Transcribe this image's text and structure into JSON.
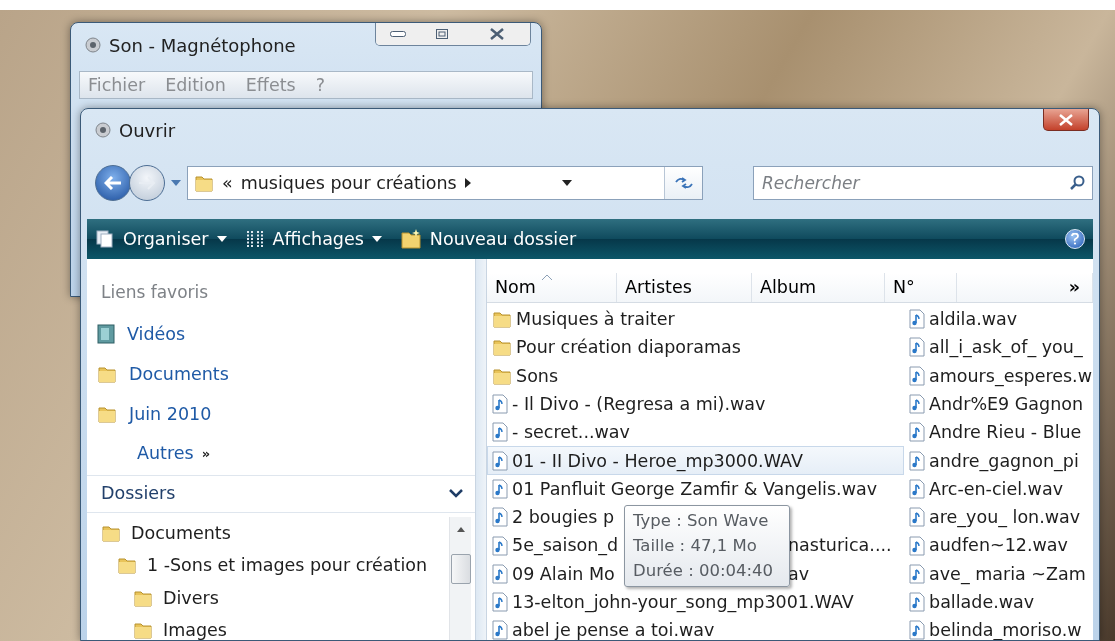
{
  "recorder_window": {
    "title": "Son - Magnétophone",
    "menu": [
      "Fichier",
      "Edition",
      "Effets",
      "?"
    ]
  },
  "dialog": {
    "title": "Ouvrir",
    "address": {
      "chevron": "«",
      "path": "musiques pour créations"
    },
    "search": {
      "placeholder": "Rechercher"
    },
    "toolbar": [
      {
        "label": "Organiser",
        "kind": "organize",
        "dropdown": true
      },
      {
        "label": "Affichages",
        "kind": "views",
        "dropdown": true
      },
      {
        "label": "Nouveau dossier",
        "kind": "new-folder",
        "dropdown": false
      }
    ],
    "favorites": {
      "title": "Liens favoris",
      "items": [
        {
          "label": "Vidéos",
          "kind": "videos"
        },
        {
          "label": "Documents",
          "kind": "folder"
        },
        {
          "label": "Juin 2010",
          "kind": "folder"
        }
      ],
      "more": "Autres",
      "more_glyph": "»"
    },
    "folders": {
      "title": "Dossiers",
      "expanded": true,
      "tree": [
        {
          "label": "Documents",
          "children": [
            {
              "label": "1 -Sons et images pour création",
              "children": [
                {
                  "label": "Divers"
                },
                {
                  "label": "Images"
                }
              ]
            }
          ]
        }
      ]
    },
    "columns": [
      {
        "label": "Nom",
        "sorted": true
      },
      {
        "label": "Artistes",
        "sorted": false
      },
      {
        "label": "Album",
        "sorted": false
      },
      {
        "label": "N°",
        "sorted": false
      }
    ],
    "more_columns": "»",
    "files_column_1": [
      {
        "name": "Musiques à traiter",
        "kind": "folder",
        "highlighted": false
      },
      {
        "name": "Pour création diaporamas",
        "kind": "folder",
        "highlighted": false
      },
      {
        "name": "Sons",
        "kind": "folder",
        "highlighted": false
      },
      {
        "name": "- Il Divo - (Regresa a mi).wav",
        "kind": "audio",
        "highlighted": false
      },
      {
        "name": "- secret...wav",
        "kind": "audio",
        "highlighted": false
      },
      {
        "name": "01 - II Divo - Heroe_mp3000.WAV",
        "kind": "audio",
        "highlighted": true
      },
      {
        "name": "01 Panfluit George Zamfir & Vangelis.wav",
        "kind": "audio",
        "highlighted": false
      },
      {
        "name": "2 bougies p",
        "kind": "audio",
        "highlighted": false
      },
      {
        "name": "5e_saison_d",
        "tail": "nasturica....",
        "kind": "audio",
        "highlighted": false
      },
      {
        "name": "09 Alain Mo",
        "tail": "av",
        "kind": "audio",
        "highlighted": false
      },
      {
        "name": "13-elton_john-your_song_mp3001.WAV",
        "kind": "audio",
        "highlighted": false
      },
      {
        "name": "abel je  pense a toi.wav",
        "kind": "audio",
        "highlighted": false
      }
    ],
    "files_column_2": [
      {
        "name": "aldila.wav",
        "kind": "audio"
      },
      {
        "name": "all_i_ask_of_ you_",
        "kind": "audio"
      },
      {
        "name": "amours_esperes.w",
        "kind": "audio"
      },
      {
        "name": "Andr%E9 Gagnon",
        "kind": "audio"
      },
      {
        "name": "Andre Rieu - Blue",
        "kind": "audio"
      },
      {
        "name": "andre_gagnon_pi",
        "kind": "audio"
      },
      {
        "name": "Arc-en-ciel.wav",
        "kind": "audio"
      },
      {
        "name": "are_you_ lon.wav",
        "kind": "audio"
      },
      {
        "name": "audfen~12.wav",
        "kind": "audio"
      },
      {
        "name": "ave_ maria ~Zam",
        "kind": "audio"
      },
      {
        "name": "ballade.wav",
        "kind": "audio"
      },
      {
        "name": "belinda_moriso.w",
        "kind": "audio"
      }
    ],
    "tooltip": {
      "lines": [
        "Type : Son Wave",
        "Taille : 47,1 Mo",
        "Durée : 00:04:40"
      ]
    }
  }
}
